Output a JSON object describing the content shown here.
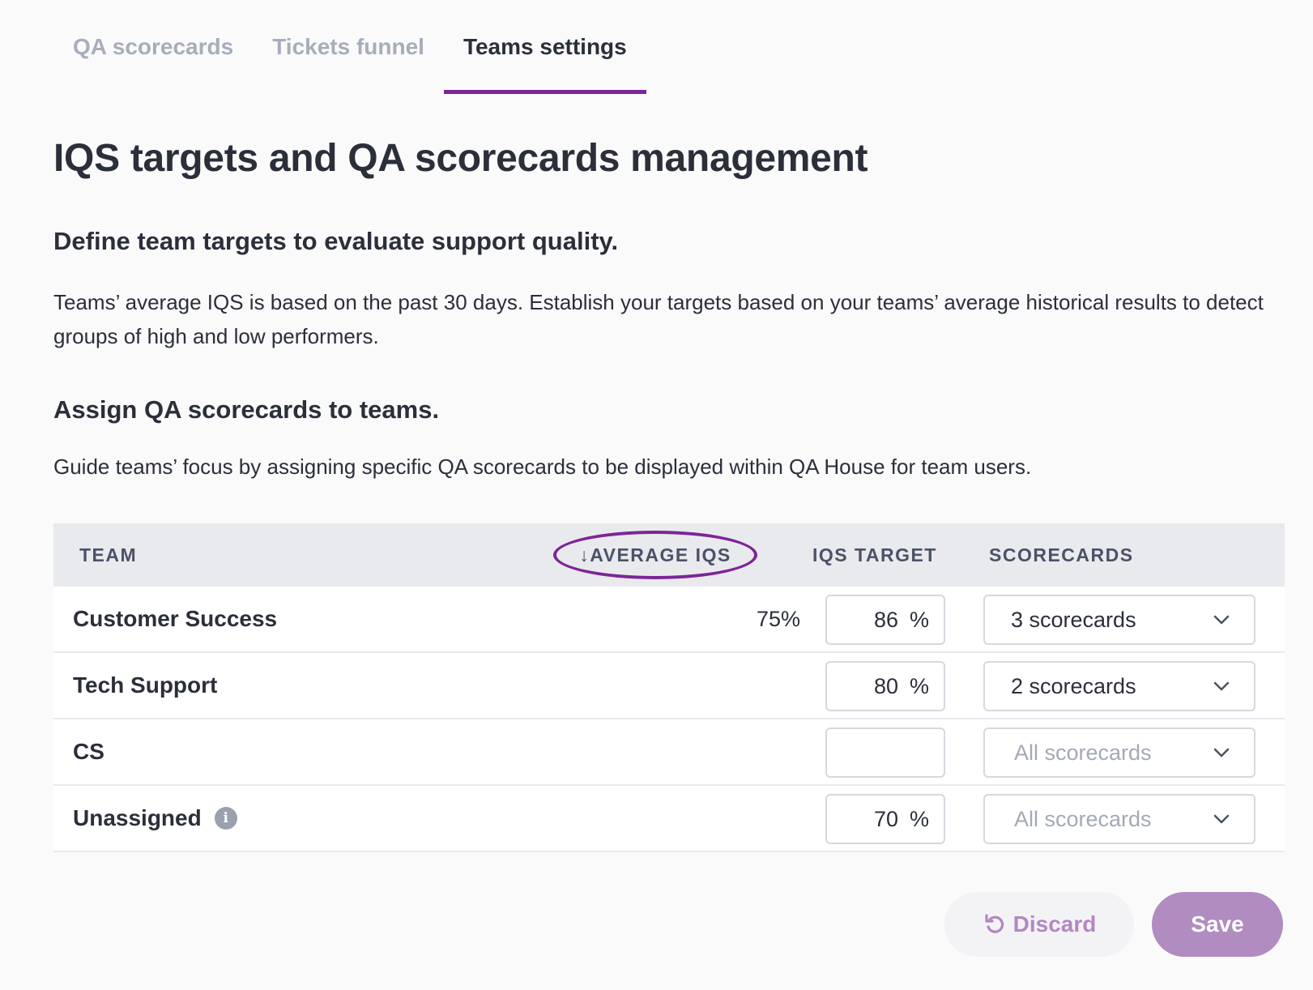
{
  "tabs": [
    {
      "label": "QA scorecards",
      "active": false
    },
    {
      "label": "Tickets funnel",
      "active": false
    },
    {
      "label": "Teams settings",
      "active": true
    }
  ],
  "page_title": "IQS targets and QA scorecards management",
  "section_targets": {
    "heading": "Define team targets to evaluate support quality.",
    "description": "Teams’ average IQS is based on the past 30 days. Establish your targets based on your teams’ average historical results to detect groups of high and low performers."
  },
  "section_scorecards": {
    "heading": "Assign QA scorecards to teams.",
    "description": "Guide teams’ focus by assigning specific QA scorecards to be displayed within QA House for team users."
  },
  "table": {
    "headers": {
      "team": "TEAM",
      "average_iqs": "↓AVERAGE IQS",
      "iqs_target": "IQS TARGET",
      "scorecards": "SCORECARDS"
    },
    "rows": [
      {
        "team": "Customer Success",
        "average_iqs": "75%",
        "target": "86",
        "target_unit": "%",
        "scorecards": "3 scorecards",
        "scorecards_placeholder": false,
        "info": false
      },
      {
        "team": "Tech Support",
        "average_iqs": "",
        "target": "80",
        "target_unit": "%",
        "scorecards": "2 scorecards",
        "scorecards_placeholder": false,
        "info": false
      },
      {
        "team": "CS",
        "average_iqs": "",
        "target": "",
        "target_unit": "",
        "scorecards": "All scorecards",
        "scorecards_placeholder": true,
        "info": false
      },
      {
        "team": "Unassigned",
        "average_iqs": "",
        "target": "70",
        "target_unit": "%",
        "scorecards": "All scorecards",
        "scorecards_placeholder": true,
        "info": true
      }
    ]
  },
  "buttons": {
    "discard": "Discard",
    "save": "Save"
  },
  "colors": {
    "accent": "#7c2596",
    "save_bg": "#b08cc0",
    "discard_text": "#b386c3"
  },
  "icons": {
    "sort": "arrow-down-icon",
    "info": "info-icon",
    "chevron": "chevron-down-icon",
    "undo": "undo-icon"
  }
}
